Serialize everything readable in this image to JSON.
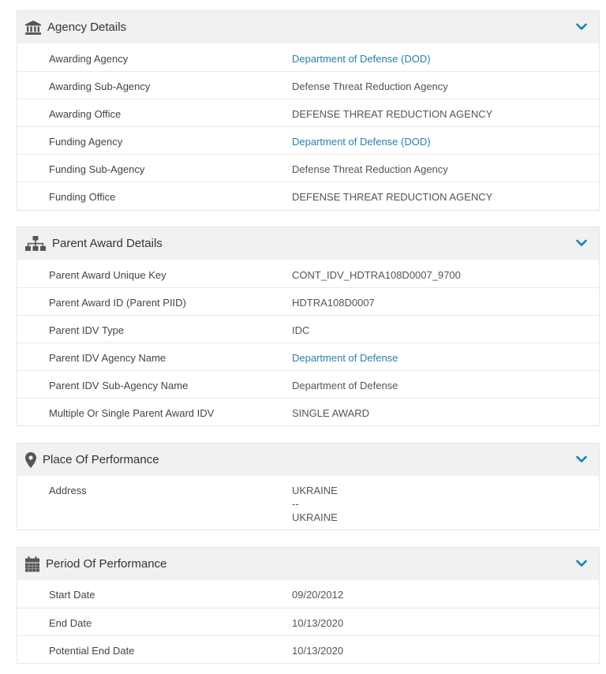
{
  "agency": {
    "title": "Agency Details",
    "rows": [
      {
        "label": "Awarding Agency",
        "value": "Department of Defense (DOD)"
      },
      {
        "label": "Awarding Sub-Agency",
        "value": "Defense Threat Reduction Agency"
      },
      {
        "label": "Awarding Office",
        "value": "DEFENSE THREAT REDUCTION AGENCY"
      },
      {
        "label": "Funding Agency",
        "value": "Department of Defense (DOD)"
      },
      {
        "label": "Funding Sub-Agency",
        "value": "Defense Threat Reduction Agency"
      },
      {
        "label": "Funding Office",
        "value": "DEFENSE THREAT REDUCTION AGENCY"
      }
    ]
  },
  "parent": {
    "title": "Parent Award Details",
    "rows": [
      {
        "label": "Parent Award Unique Key",
        "value": "CONT_IDV_HDTRA108D0007_9700"
      },
      {
        "label": "Parent Award ID (Parent PIID)",
        "value": "HDTRA108D0007"
      },
      {
        "label": "Parent IDV Type",
        "value": "IDC"
      },
      {
        "label": "Parent IDV Agency Name",
        "value": "Department of Defense"
      },
      {
        "label": "Parent IDV Sub-Agency Name",
        "value": "Department of Defense"
      },
      {
        "label": "Multiple Or Single Parent Award IDV",
        "value": "SINGLE AWARD"
      }
    ]
  },
  "place": {
    "title": "Place Of Performance",
    "address_label": "Address",
    "address_lines": [
      "UKRAINE",
      "--",
      "UKRAINE"
    ]
  },
  "period": {
    "title": "Period Of Performance",
    "rows": [
      {
        "label": "Start Date",
        "value": "09/20/2012"
      },
      {
        "label": "End Date",
        "value": "10/13/2020"
      },
      {
        "label": "Potential End Date",
        "value": "10/13/2020"
      }
    ]
  },
  "colors": {
    "link": "#2a7fa8",
    "header_bg": "#f1f1f1",
    "chevron": "#1a7fb5"
  }
}
